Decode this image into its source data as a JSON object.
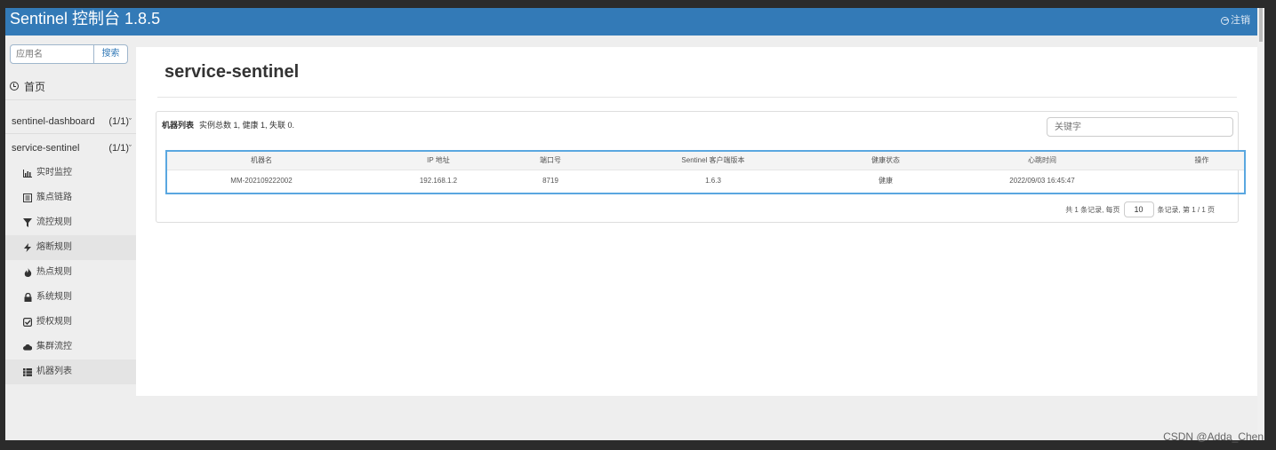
{
  "header": {
    "brand": "Sentinel 控制台 1.8.5",
    "logout_label": "注销"
  },
  "sidebar": {
    "search_placeholder": "应用名",
    "search_button": "搜索",
    "home_label": "首页",
    "apps": [
      {
        "name": "sentinel-dashboard",
        "count": "(1/1)"
      },
      {
        "name": "service-sentinel",
        "count": "(1/1)"
      }
    ],
    "menu": [
      {
        "label": "实时监控",
        "icon": "bar-chart-icon"
      },
      {
        "label": "簇点链路",
        "icon": "list-box-icon"
      },
      {
        "label": "流控规则",
        "icon": "filter-icon"
      },
      {
        "label": "熔断规则",
        "icon": "flash-icon"
      },
      {
        "label": "热点规则",
        "icon": "fire-icon"
      },
      {
        "label": "系统规则",
        "icon": "lock-icon"
      },
      {
        "label": "授权规则",
        "icon": "check-square-icon"
      },
      {
        "label": "集群流控",
        "icon": "cloud-icon"
      },
      {
        "label": "机器列表",
        "icon": "th-list-icon"
      }
    ]
  },
  "main": {
    "title": "service-sentinel",
    "panel": {
      "title": "机器列表",
      "summary": "实例总数 1, 健康 1, 失联 0.",
      "keyword_placeholder": "关键字"
    },
    "table": {
      "headers": [
        "机器名",
        "IP 地址",
        "端口号",
        "Sentinel 客户端版本",
        "健康状态",
        "心跳时间",
        "操作"
      ],
      "rows": [
        [
          "MM-202109222002",
          "192.168.1.2",
          "8719",
          "1.6.3",
          "健康",
          "2022/09/03 16:45:47",
          ""
        ]
      ]
    },
    "pager": {
      "prefix": "共 1 条记录, 每页",
      "page_size": "10",
      "suffix": "条记录, 第 1 / 1 页"
    }
  },
  "watermark": "CSDN @Adda_Chen",
  "colors": {
    "navbar": "#337ab7",
    "table_highlight": "#5aa7e0"
  }
}
